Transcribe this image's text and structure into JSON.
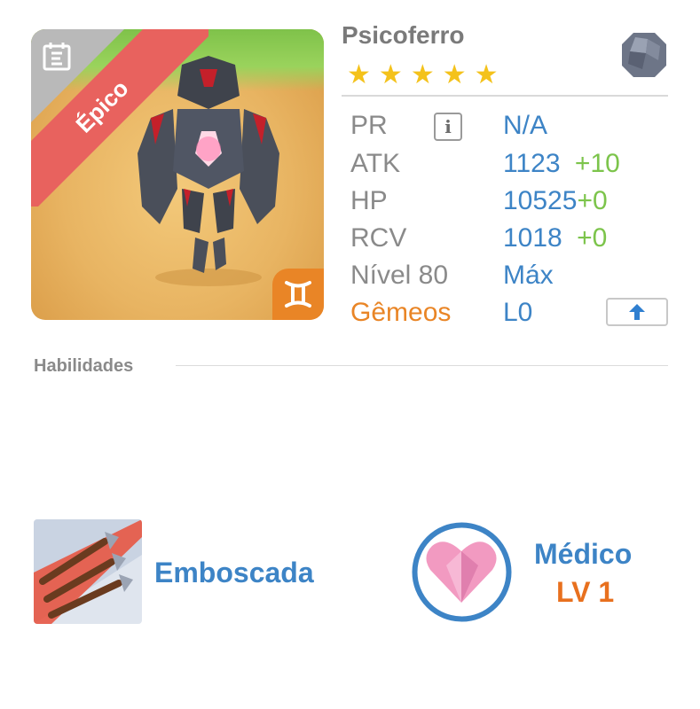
{
  "monster": {
    "name": "Psicoferro",
    "rarity": "Épico",
    "stars": [
      "★",
      "★",
      "★",
      "★",
      "★"
    ],
    "element_icon": "stone-element-icon",
    "zodiac_symbol": "♊"
  },
  "stats": {
    "pr": {
      "label": "PR",
      "value": "N/A"
    },
    "atk": {
      "label": "ATK",
      "value": "1123",
      "bonus": "+10"
    },
    "hp": {
      "label": "HP",
      "value": "10525",
      "bonus": "+0"
    },
    "rcv": {
      "label": "RCV",
      "value": "1018",
      "bonus": "+0"
    },
    "level": {
      "label": "Nível 80",
      "value": "Máx"
    },
    "zodiac": {
      "label": "Gêmeos",
      "value": "L0"
    }
  },
  "section": {
    "title": "Habilidades"
  },
  "skill": {
    "name": "Emboscada"
  },
  "leader": {
    "name": "Médico",
    "level": "LV 1"
  },
  "colors": {
    "accent_blue": "#3d84c6",
    "bonus_green": "#7cc44b",
    "orange": "#e98526",
    "rarity_red": "#e8625e"
  }
}
